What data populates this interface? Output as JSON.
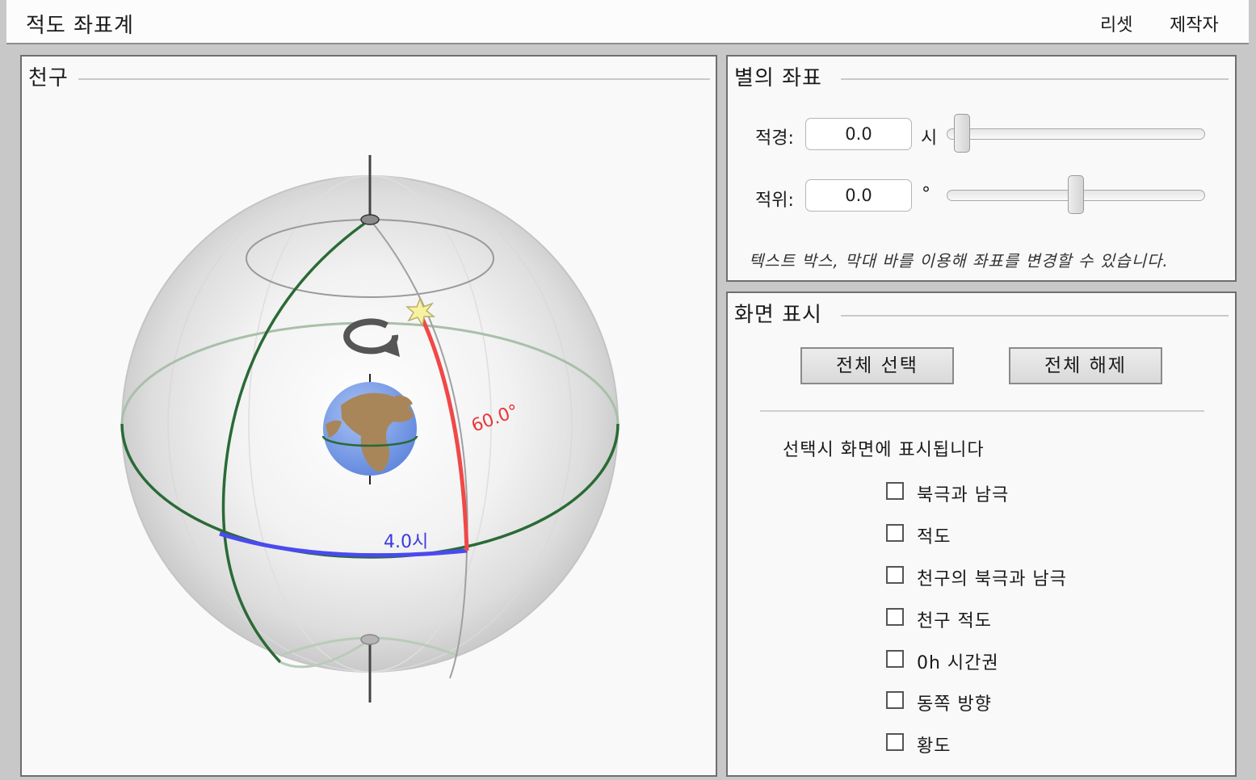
{
  "app": {
    "title": "적도 좌표계"
  },
  "menu": {
    "reset": "리셋",
    "author": "제작자"
  },
  "sphere_panel": {
    "legend": "천구",
    "ra_label": "4.0시",
    "dec_label": "60.0°"
  },
  "coords_panel": {
    "legend": "별의 좌표",
    "ra": {
      "label": "적경:",
      "value": "0.0",
      "unit": "시",
      "slider_fraction": 0.0
    },
    "dec": {
      "label": "적위:",
      "value": "0.0",
      "unit": "°",
      "slider_fraction": 0.5
    },
    "hint": "텍스트 박스, 막대 바를 이용해 좌표를 변경할 수 있습니다."
  },
  "display_panel": {
    "legend": "화면 표시",
    "select_all": "전체 선택",
    "deselect_all": "전체 해제",
    "subtitle": "선택시 화면에 표시됩니다",
    "options": [
      {
        "label": "북극과 남극",
        "checked": false
      },
      {
        "label": "적도",
        "checked": false
      },
      {
        "label": "천구의 북극과 남극",
        "checked": false
      },
      {
        "label": "천구 적도",
        "checked": false
      },
      {
        "label": "0h 시간권",
        "checked": false
      },
      {
        "label": "동쪽 방향",
        "checked": false
      },
      {
        "label": "황도",
        "checked": false
      }
    ]
  },
  "colors": {
    "meridian": "#2a6a36",
    "equator_front": "#2a6a36",
    "ra_arc": "#4a4af0",
    "dec_arc": "#f04848",
    "ocean": "#7aa0e8",
    "land": "#a9865a"
  }
}
